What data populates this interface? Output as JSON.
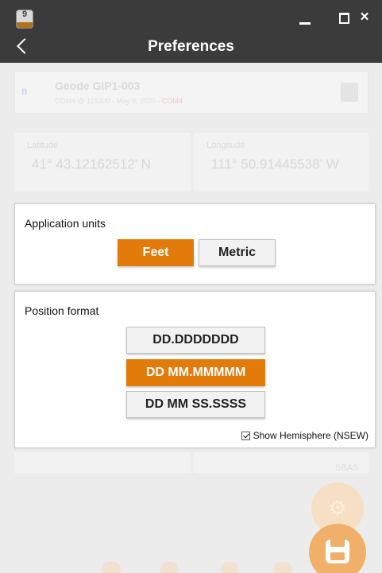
{
  "window": {
    "app_icon_number": "9",
    "minimize_icon": "minimize-icon",
    "maximize_icon": "maximize-icon",
    "close_glyph": "×"
  },
  "header": {
    "title": "Preferences",
    "back_icon": "chevron-left-icon"
  },
  "background": {
    "device": {
      "name": "Geode GiP1-003",
      "connection": "COM4 @ 115200 - May 8, 2020 - ",
      "warning": "COM4"
    },
    "latitude": {
      "label": "Latitude",
      "value": "41° 43.12162512' N"
    },
    "longitude": {
      "label": "Longitude",
      "value": "111° 50.91445538' W"
    },
    "sbas_label": "SBAS"
  },
  "units": {
    "title": "Application units",
    "options": [
      "Feet",
      "Metric"
    ],
    "selected": "Feet"
  },
  "format": {
    "title": "Position format",
    "options": [
      "DD.DDDDDDD",
      "DD MM.MMMMM",
      "DD MM SS.SSSS"
    ],
    "selected": "DD MM.MMMMM",
    "hemisphere_label": "Show Hemisphere (NSEW)",
    "hemisphere_checked": true
  },
  "colors": {
    "accent": "#e27b0a",
    "titlebar": "#3b3b3b"
  }
}
